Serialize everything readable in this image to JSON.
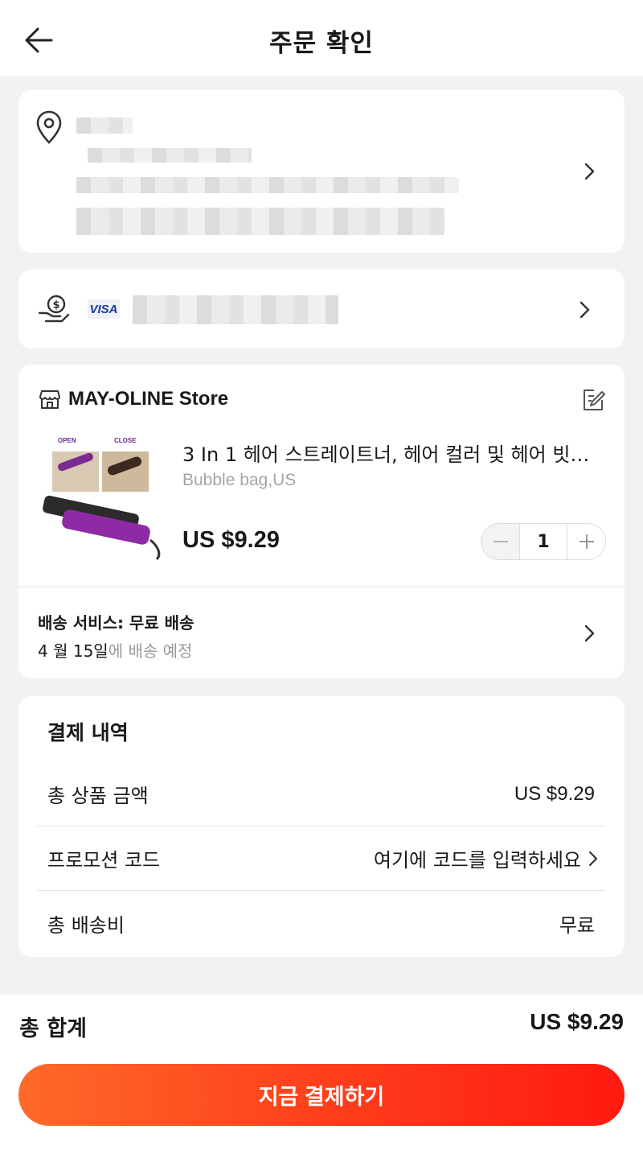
{
  "header": {
    "title": "주문 확인"
  },
  "payment": {
    "card_brand": "VISA"
  },
  "store": {
    "name": "MAY-OLINE Store"
  },
  "product": {
    "title": "3 In 1 헤어 스트레이트너, 헤어 컬러 및 헤어 빗…",
    "variant": "Bubble bag,US",
    "price": "US $9.29",
    "quantity": "1",
    "image_labels": {
      "open": "OPEN",
      "close": "CLOSE"
    }
  },
  "shipping": {
    "service": "배송 서비스: 무료 배송",
    "date": "4 월 15일",
    "date_suffix": "에 배송 예정"
  },
  "summary": {
    "title": "결제 내역",
    "rows": [
      {
        "label": "총 상품 금액",
        "value": "US $9.29"
      },
      {
        "label": "프로모션 코드",
        "value": "여기에 코드를 입력하세요"
      },
      {
        "label": "총 배송비",
        "value": "무료"
      }
    ]
  },
  "footer": {
    "total_label": "총 합계",
    "total_value": "US $9.29",
    "pay_button": "지금 결제하기"
  },
  "colors": {
    "accent_start": "#ff6a28",
    "accent_end": "#ff1a10"
  }
}
